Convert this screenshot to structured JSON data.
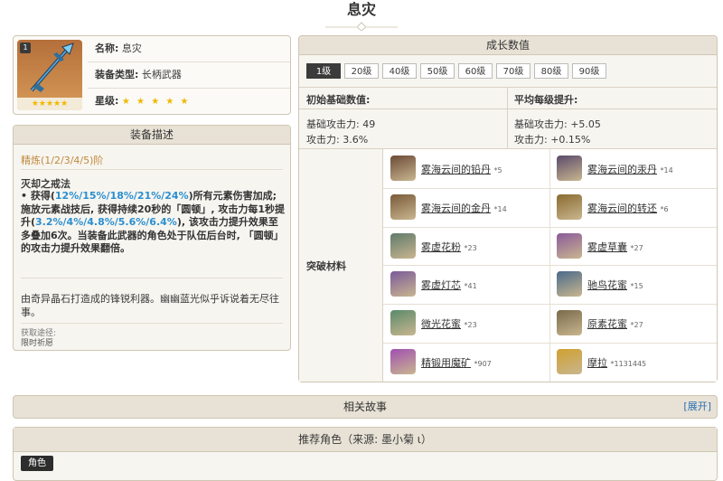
{
  "page": {
    "title": "息灾"
  },
  "weapon": {
    "rarity_badge": "1",
    "name_label": "名称:",
    "name": "息灾",
    "type_label": "装备类型:",
    "type": "长柄武器",
    "stars_label": "星级:",
    "stars": "★ ★ ★ ★ ★",
    "icon_stars": "★★★★★"
  },
  "description": {
    "header": "装备描述",
    "refinement": "精炼(1/2/3/4/5)阶",
    "skill_name": "灭却之戒法",
    "skill_text_1": "• 获得(",
    "skill_values_1": "12%/15%/18%/21%/24%",
    "skill_text_2": ")所有元素伤害加成; 施放元素战技后, 获得持续20秒的「圆顿」, 攻击力每1秒提升(",
    "skill_values_2": "3.2%/4%/4.8%/5.6%/6.4%",
    "skill_text_3": "), 该攻击力提升效果至多叠加6次。当装备此武器的角色处于队伍后台时, 「圆顿」的攻击力提升效果翻倍。",
    "flavor": "由奇异晶石打造成的锋锐利器。幽幽蓝光似乎诉说着无尽往事。",
    "source_label": "获取途径:",
    "source": "限时祈愿"
  },
  "growth": {
    "header": "成长数值",
    "levels": [
      "1级",
      "20级",
      "40级",
      "50级",
      "60级",
      "70级",
      "80级",
      "90级"
    ],
    "base_header": "初始基础数值:",
    "avg_header": "平均每级提升:",
    "base_atk": "基础攻击力: 49",
    "base_sub": "攻击力: 3.6%",
    "avg_atk": "基础攻击力: +5.05",
    "avg_sub": "攻击力: +0.15%",
    "materials_label": "突破材料",
    "materials": [
      {
        "name": "雾海云间的铅丹",
        "count": "*5"
      },
      {
        "name": "雾海云间的汞丹",
        "count": "*14"
      },
      {
        "name": "雾海云间的金丹",
        "count": "*14"
      },
      {
        "name": "雾海云间的转还",
        "count": "*6"
      },
      {
        "name": "雾虚花粉",
        "count": "*23"
      },
      {
        "name": "雾虚草囊",
        "count": "*27"
      },
      {
        "name": "雾虚灯芯",
        "count": "*41"
      },
      {
        "name": "驰鸟花蜜",
        "count": "*15"
      },
      {
        "name": "微光花蜜",
        "count": "*23"
      },
      {
        "name": "原素花蜜",
        "count": "*27"
      },
      {
        "name": "精锻用魔矿",
        "count": "*907"
      },
      {
        "name": "摩拉",
        "count": "*1131445"
      }
    ]
  },
  "story": {
    "header": "相关故事",
    "expand": "[展开]"
  },
  "recommend": {
    "header": "推荐角色（来源: 墨小菊 ι）",
    "role_tag": "角色"
  },
  "colors": {
    "panel_bg": "#f7f5f0",
    "header_bg": "#e8e2d6",
    "border": "#cfc6b3",
    "highlight": "#2a8fd1",
    "star": "#f0b800"
  }
}
